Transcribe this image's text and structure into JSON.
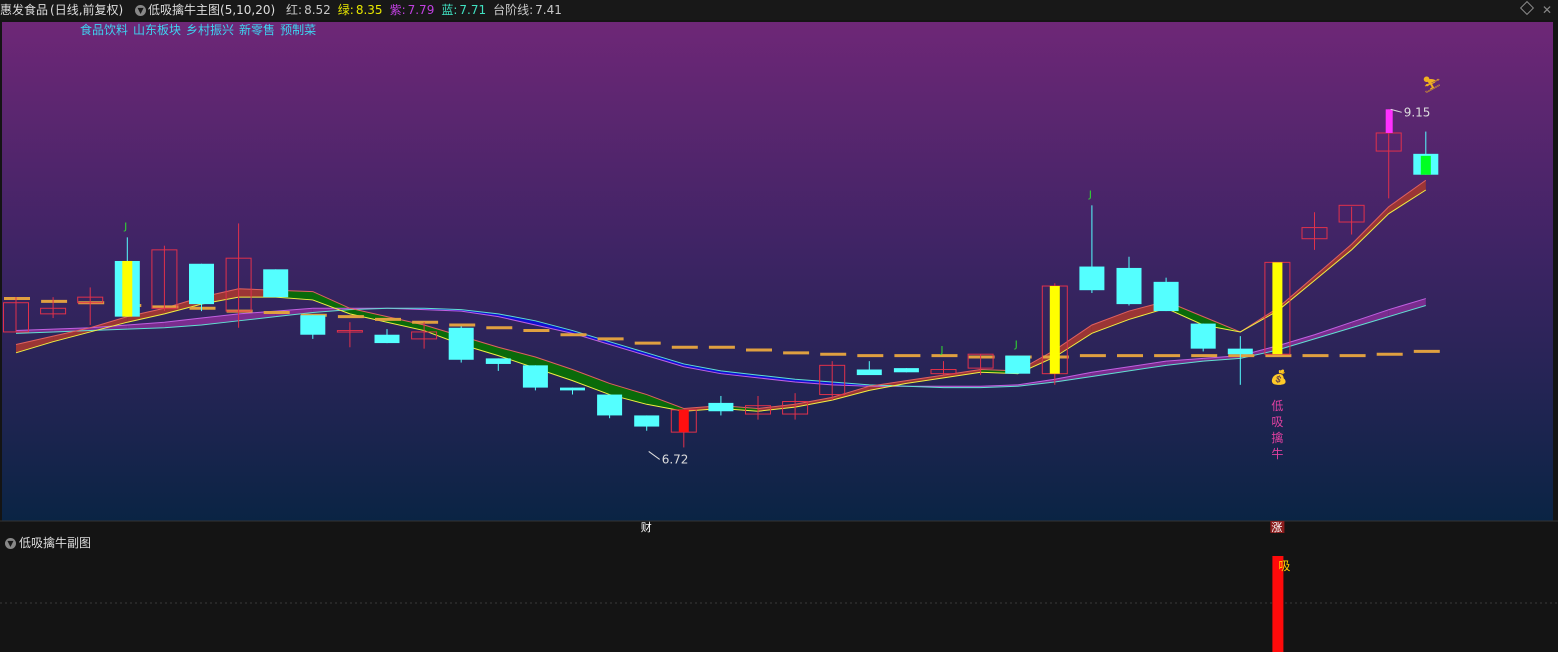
{
  "header": {
    "stock_name": "惠发食品",
    "period_label": "(日线,前复权)",
    "indicator_name": "低吸擒牛主图(5,10,20)",
    "values": [
      {
        "label": "红:",
        "value": "8.52",
        "label_color": "#c8c8c8",
        "value_color": "#c8c8c8"
      },
      {
        "label": "绿:",
        "value": "8.35",
        "label_color": "#e8e800",
        "value_color": "#e8e800"
      },
      {
        "label": "紫:",
        "value": "7.79",
        "label_color": "#c040e0",
        "value_color": "#c040e0"
      },
      {
        "label": "蓝:",
        "value": "7.71",
        "label_color": "#40e0c0",
        "value_color": "#40e0c0"
      },
      {
        "label": "台阶线:",
        "value": "7.41",
        "label_color": "#c8c8c8",
        "value_color": "#c8c8c8"
      }
    ]
  },
  "tags": [
    "食品饮料",
    "山东板块",
    "乡村振兴",
    "新零售",
    "预制菜"
  ],
  "sub_panel": {
    "title": "低吸擒牛副图"
  },
  "colors": {
    "up": "#e0314b",
    "down": "#54ffff",
    "grad_top": "#6e2777",
    "grad_bottom": "#0a2444"
  },
  "chart_data": {
    "type": "candlestick",
    "ylim": [
      6.45,
      9.72
    ],
    "candles": [
      {
        "o": 7.55,
        "h": 7.8,
        "l": 7.55,
        "c": 7.76
      },
      {
        "o": 7.68,
        "h": 7.8,
        "l": 7.65,
        "c": 7.72
      },
      {
        "o": 7.76,
        "h": 7.87,
        "l": 7.6,
        "c": 7.8
      },
      {
        "o": 8.06,
        "h": 8.23,
        "l": 7.66,
        "c": 7.66
      },
      {
        "o": 7.72,
        "h": 8.17,
        "l": 7.7,
        "c": 8.14
      },
      {
        "o": 8.04,
        "h": 8.04,
        "l": 7.7,
        "c": 7.75
      },
      {
        "o": 7.7,
        "h": 8.33,
        "l": 7.58,
        "c": 8.08
      },
      {
        "o": 8.0,
        "h": 8.0,
        "l": 7.8,
        "c": 7.8
      },
      {
        "o": 7.67,
        "h": 7.67,
        "l": 7.5,
        "c": 7.53
      },
      {
        "o": 7.56,
        "h": 7.62,
        "l": 7.44,
        "c": 7.56
      },
      {
        "o": 7.53,
        "h": 7.57,
        "l": 7.47,
        "c": 7.47
      },
      {
        "o": 7.5,
        "h": 7.62,
        "l": 7.43,
        "c": 7.55
      },
      {
        "o": 7.58,
        "h": 7.59,
        "l": 7.33,
        "c": 7.35
      },
      {
        "o": 7.36,
        "h": 7.36,
        "l": 7.27,
        "c": 7.32
      },
      {
        "o": 7.31,
        "h": 7.31,
        "l": 7.13,
        "c": 7.15
      },
      {
        "o": 7.15,
        "h": 7.15,
        "l": 7.1,
        "c": 7.13
      },
      {
        "o": 7.1,
        "h": 7.1,
        "l": 6.93,
        "c": 6.95
      },
      {
        "o": 6.95,
        "h": 6.95,
        "l": 6.84,
        "c": 6.87
      },
      {
        "o": 6.83,
        "h": 6.99,
        "l": 6.72,
        "c": 6.99
      },
      {
        "o": 7.04,
        "h": 7.09,
        "l": 6.95,
        "c": 6.98
      },
      {
        "o": 6.96,
        "h": 7.09,
        "l": 6.92,
        "c": 7.02
      },
      {
        "o": 6.96,
        "h": 7.11,
        "l": 6.92,
        "c": 7.05
      },
      {
        "o": 7.1,
        "h": 7.34,
        "l": 7.06,
        "c": 7.31
      },
      {
        "o": 7.28,
        "h": 7.34,
        "l": 7.26,
        "c": 7.24
      },
      {
        "o": 7.29,
        "h": 7.29,
        "l": 7.26,
        "c": 7.26
      },
      {
        "o": 7.25,
        "h": 7.34,
        "l": 7.24,
        "c": 7.28
      },
      {
        "o": 7.29,
        "h": 7.39,
        "l": 7.24,
        "c": 7.39
      },
      {
        "o": 7.38,
        "h": 7.38,
        "l": 7.25,
        "c": 7.25
      },
      {
        "o": 7.25,
        "h": 7.9,
        "l": 7.17,
        "c": 7.88
      },
      {
        "o": 8.02,
        "h": 8.46,
        "l": 7.83,
        "c": 7.85
      },
      {
        "o": 8.01,
        "h": 8.09,
        "l": 7.74,
        "c": 7.75
      },
      {
        "o": 7.91,
        "h": 7.94,
        "l": 7.7,
        "c": 7.7
      },
      {
        "o": 7.61,
        "h": 7.61,
        "l": 7.41,
        "c": 7.43
      },
      {
        "o": 7.43,
        "h": 7.52,
        "l": 7.17,
        "c": 7.39
      },
      {
        "o": 7.39,
        "h": 8.05,
        "l": 7.39,
        "c": 8.05
      },
      {
        "o": 8.22,
        "h": 8.41,
        "l": 8.14,
        "c": 8.3
      },
      {
        "o": 8.34,
        "h": 8.45,
        "l": 8.25,
        "c": 8.46
      },
      {
        "o": 8.85,
        "h": 9.15,
        "l": 8.51,
        "c": 8.98
      },
      {
        "o": 8.83,
        "h": 8.99,
        "l": 8.68,
        "c": 8.68
      }
    ],
    "ma_red": [
      7.46,
      7.52,
      7.58,
      7.66,
      7.72,
      7.8,
      7.86,
      7.85,
      7.84,
      7.72,
      7.66,
      7.6,
      7.52,
      7.44,
      7.37,
      7.28,
      7.18,
      7.1,
      7.0,
      7.02,
      7.0,
      7.03,
      7.08,
      7.16,
      7.2,
      7.24,
      7.28,
      7.27,
      7.42,
      7.6,
      7.7,
      7.77,
      7.66,
      7.55,
      7.72,
      7.95,
      8.18,
      8.45,
      8.64
    ],
    "ma_yellow": [
      7.4,
      7.48,
      7.55,
      7.62,
      7.68,
      7.75,
      7.8,
      7.8,
      7.78,
      7.68,
      7.62,
      7.56,
      7.46,
      7.38,
      7.29,
      7.2,
      7.1,
      7.03,
      6.98,
      7.0,
      6.98,
      7.01,
      7.06,
      7.13,
      7.18,
      7.22,
      7.26,
      7.25,
      7.37,
      7.54,
      7.64,
      7.72,
      7.6,
      7.55,
      7.7,
      7.92,
      8.14,
      8.4,
      8.57
    ],
    "ma_purple": [
      7.56,
      7.57,
      7.58,
      7.6,
      7.62,
      7.65,
      7.68,
      7.7,
      7.72,
      7.72,
      7.72,
      7.71,
      7.7,
      7.66,
      7.6,
      7.54,
      7.46,
      7.38,
      7.3,
      7.25,
      7.22,
      7.19,
      7.17,
      7.16,
      7.16,
      7.16,
      7.16,
      7.17,
      7.21,
      7.26,
      7.3,
      7.34,
      7.36,
      7.38,
      7.45,
      7.53,
      7.62,
      7.71,
      7.79
    ],
    "ma_cyan": [
      7.54,
      7.55,
      7.56,
      7.57,
      7.58,
      7.6,
      7.63,
      7.66,
      7.69,
      7.71,
      7.72,
      7.72,
      7.71,
      7.68,
      7.63,
      7.56,
      7.48,
      7.4,
      7.32,
      7.27,
      7.24,
      7.21,
      7.19,
      7.17,
      7.16,
      7.15,
      7.15,
      7.16,
      7.19,
      7.23,
      7.27,
      7.31,
      7.34,
      7.36,
      7.42,
      7.5,
      7.58,
      7.66,
      7.74
    ],
    "step_line": [
      7.79,
      7.77,
      7.76,
      7.74,
      7.73,
      7.72,
      7.7,
      7.69,
      7.67,
      7.66,
      7.64,
      7.62,
      7.6,
      7.58,
      7.56,
      7.53,
      7.5,
      7.47,
      7.44,
      7.44,
      7.42,
      7.4,
      7.39,
      7.38,
      7.38,
      7.38,
      7.37,
      7.37,
      7.37,
      7.38,
      7.38,
      7.38,
      7.38,
      7.38,
      7.38,
      7.38,
      7.38,
      7.39,
      7.41
    ],
    "yellow_bar_candles": [
      3,
      28,
      34
    ],
    "j_marks": [
      3,
      25,
      27,
      29
    ],
    "annotations": [
      {
        "candle": 37,
        "price": 9.15,
        "text": "9.15"
      },
      {
        "candle": 17,
        "price": 6.72,
        "text": "6.72"
      }
    ],
    "buy_signal_candle": 34,
    "buy_signal_text": "低吸擒牛",
    "bottom_labels": [
      {
        "candle": 17,
        "text": "财"
      },
      {
        "candle": 34,
        "text": "涨"
      }
    ],
    "sub_chart": {
      "type": "bar",
      "candle": 34,
      "label": "吸"
    }
  }
}
